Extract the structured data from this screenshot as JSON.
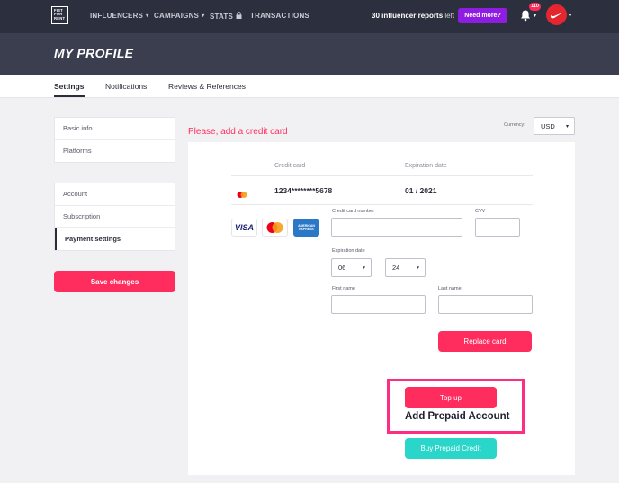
{
  "nav": {
    "logo_text": "FIST FOR RENT",
    "items": [
      {
        "label": "INFLUENCERS",
        "caret": "▾"
      },
      {
        "label": "CAMPAIGNS",
        "caret": "▾"
      },
      {
        "label": "STATS",
        "caret": "🔒"
      },
      {
        "label": "TRANSACTIONS",
        "caret": ""
      }
    ],
    "reports_count": "30 influencer reports",
    "reports_suffix": "left",
    "need_more": "Need more?",
    "notifications": "110",
    "caret": "▾",
    "avatar_icon": "nike-swoosh-icon"
  },
  "header": {
    "title": "MY PROFILE"
  },
  "tabs": [
    {
      "label": "Settings",
      "active": true
    },
    {
      "label": "Notifications",
      "active": false
    },
    {
      "label": "Reviews & References",
      "active": false
    }
  ],
  "sidebar": {
    "group1": [
      "Basic info",
      "Platforms"
    ],
    "group2": [
      "Account",
      "Subscription",
      "Payment settings"
    ],
    "active": "Payment settings",
    "save_label": "Save changes"
  },
  "main": {
    "prompt": "Please, add a credit card",
    "currency_label": "Currency:",
    "currency_value": "USD",
    "table": {
      "col_card": "Credit card",
      "col_exp": "Expiration date",
      "card_number": "1234********5678",
      "card_exp": "01 / 2021"
    },
    "brands": {
      "visa": "VISA",
      "amex": "AMERICAN EXPRESS"
    },
    "form": {
      "cc_label": "Credit card number",
      "cvv_label": "CVV",
      "exp_label": "Expiration date",
      "exp_month": "06",
      "exp_year": "24",
      "first_label": "First name",
      "last_label": "Last name"
    },
    "replace_label": "Replace card",
    "topup_label": "Top up",
    "prepaid_title": "Add Prepaid Account",
    "buy_label": "Buy Prepaid Credit"
  },
  "colors": {
    "accent": "#ff2d5e",
    "purple": "#8f1de1",
    "teal": "#2ad6c9",
    "nav_bg": "#2c2f3d",
    "header_bg": "#3b3e4e",
    "highlight": "#ff2d82"
  }
}
